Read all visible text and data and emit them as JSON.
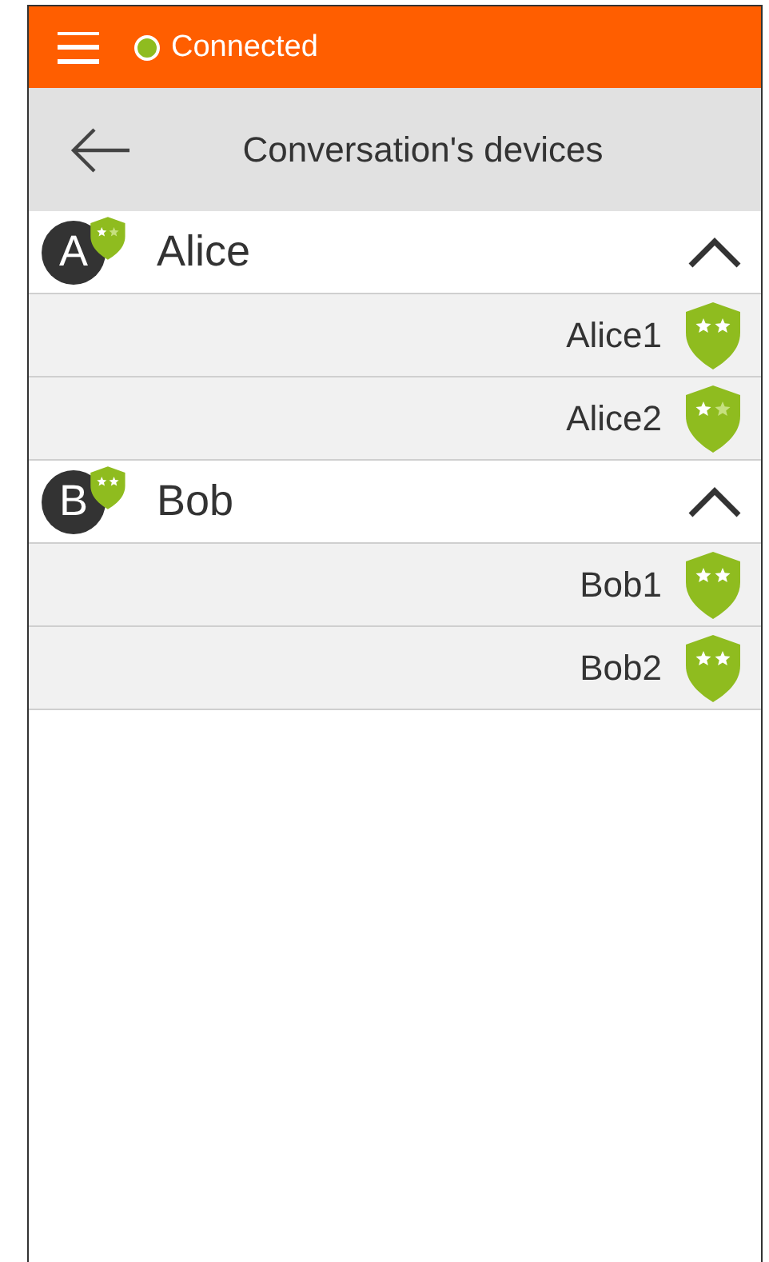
{
  "status_bar": {
    "status": "Connected",
    "connected": true
  },
  "header": {
    "title": "Conversation's devices"
  },
  "groups": [
    {
      "avatar": "A",
      "name": "Alice",
      "trusted": false,
      "expanded": true,
      "devices": [
        {
          "name": "Alice1",
          "trusted": true
        },
        {
          "name": "Alice2",
          "trusted": false
        }
      ]
    },
    {
      "avatar": "B",
      "name": "Bob",
      "trusted": true,
      "expanded": true,
      "devices": [
        {
          "name": "Bob1",
          "trusted": true
        },
        {
          "name": "Bob2",
          "trusted": true
        }
      ]
    }
  ]
}
